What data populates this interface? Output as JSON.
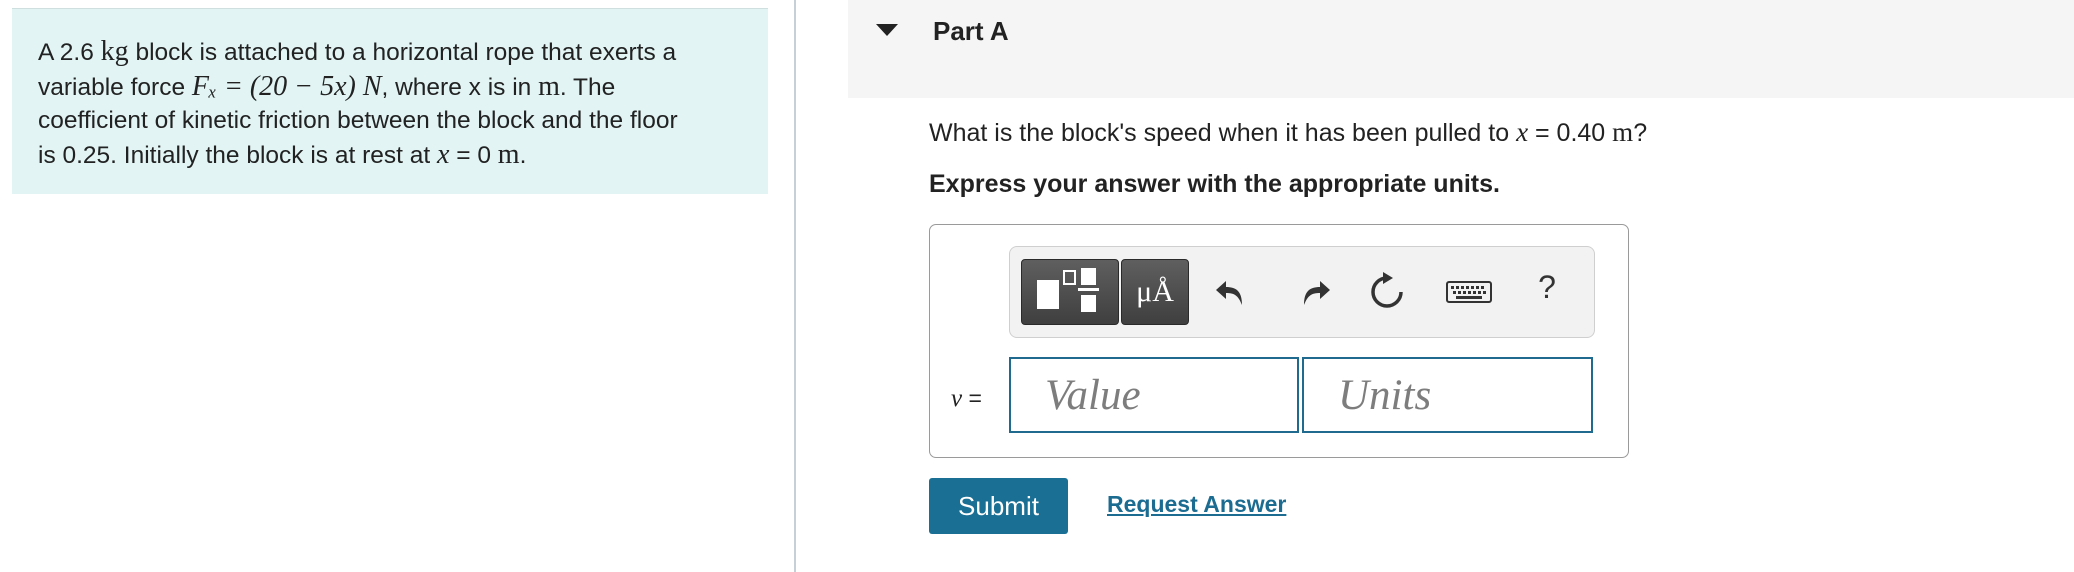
{
  "problem": {
    "line1_pre": "A 2.6 ",
    "line1_unit": "kg",
    "line1_post": " block is attached to a horizontal rope that exerts a",
    "line2_pre": "variable force ",
    "line2_force": "Fₓ = (20 − 5x) N",
    "line2_post": ", where x is in ",
    "line2_unit": "m",
    "line2_end": ". The",
    "line3": "coefficient of kinetic friction between the block and the floor",
    "line4_pre": "is 0.25. Initially the block is at rest at ",
    "line4_var": "x",
    "line4_eq": " = 0 ",
    "line4_unit": "m",
    "line4_end": "."
  },
  "part": {
    "title": "Part A",
    "question_pre": "What is the block's speed when it has been pulled to ",
    "question_var": "x",
    "question_eq": " = 0.40 ",
    "question_unit": "m",
    "question_end": "?",
    "instruction": "Express your answer with the appropriate units."
  },
  "toolbar": {
    "symbols_label": "μÅ",
    "help_label": "?",
    "icons": [
      "templates-icon",
      "undo-icon",
      "redo-icon",
      "reset-icon",
      "keyboard-icon",
      "help-icon"
    ]
  },
  "answer": {
    "variable": "v",
    "equals": " =",
    "value_placeholder": "Value",
    "units_placeholder": "Units"
  },
  "actions": {
    "submit_label": "Submit",
    "request_label": "Request Answer"
  },
  "colors": {
    "problem_bg": "#e2f4f4",
    "accent": "#1a6f94",
    "input_border": "#1f6a8e"
  }
}
